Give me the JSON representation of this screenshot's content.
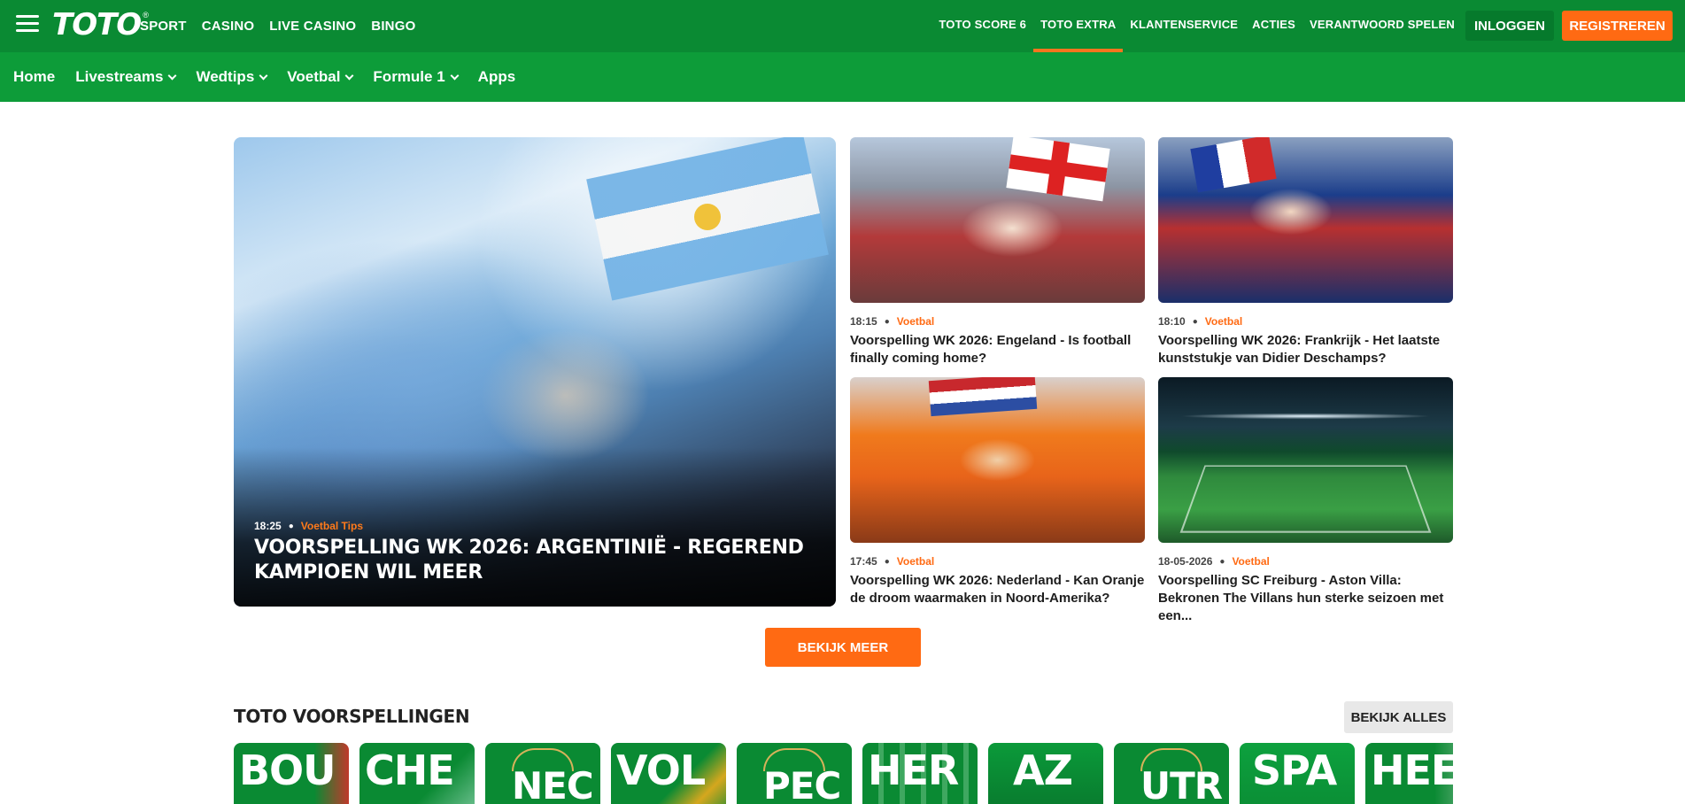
{
  "header": {
    "logo": "TOTO",
    "logo_mark": "®",
    "main_nav": [
      "SPORT",
      "CASINO",
      "LIVE CASINO",
      "BINGO"
    ],
    "right_nav": [
      "TOTO SCORE 6",
      "TOTO EXTRA",
      "KLANTENSERVICE",
      "ACTIES",
      "VERANTWOORD SPELEN"
    ],
    "active_right_nav": "TOTO EXTRA",
    "login_label": "INLOGGEN",
    "register_label": "REGISTREREN",
    "colors": {
      "brand_green": "#0a8a33",
      "accent_orange": "#ff6a13"
    }
  },
  "subnav": {
    "items": [
      {
        "label": "Home",
        "has_dropdown": false
      },
      {
        "label": "Livestreams",
        "has_dropdown": true
      },
      {
        "label": "Wedtips",
        "has_dropdown": true
      },
      {
        "label": "Voetbal",
        "has_dropdown": true
      },
      {
        "label": "Formule 1",
        "has_dropdown": true
      },
      {
        "label": "Apps",
        "has_dropdown": false
      }
    ]
  },
  "hero": {
    "time": "18:25",
    "category": "Voetbal Tips",
    "title": "VOORSPELLING WK 2026: ARGENTINIË - REGEREND KAMPIOEN WIL MEER"
  },
  "articles": [
    {
      "time": "18:15",
      "category": "Voetbal",
      "title": "Voorspelling WK 2026: Engeland - Is football finally coming home?"
    },
    {
      "time": "18:10",
      "category": "Voetbal",
      "title": "Voorspelling WK 2026: Frankrijk - Het laatste kunststukje van Didier Deschamps?"
    },
    {
      "time": "17:45",
      "category": "Voetbal",
      "title": "Voorspelling WK 2026: Nederland - Kan Oranje de droom waarmaken in Noord-Amerika?"
    },
    {
      "time": "18-05-2026",
      "category": "Voetbal",
      "title": "Voorspelling SC Freiburg - Aston Villa: Bekronen The Villans hun sterke seizoen met een..."
    }
  ],
  "more_button": "BEKIJK MEER",
  "predictions": {
    "title": "TOTO VOORSPELLINGEN",
    "see_all": "BEKIJK ALLES",
    "tiles": [
      "BOU",
      "CHE",
      "NEC",
      "VOL",
      "PEC",
      "HER",
      "AZ",
      "UTR",
      "SPA",
      "HEE"
    ]
  }
}
